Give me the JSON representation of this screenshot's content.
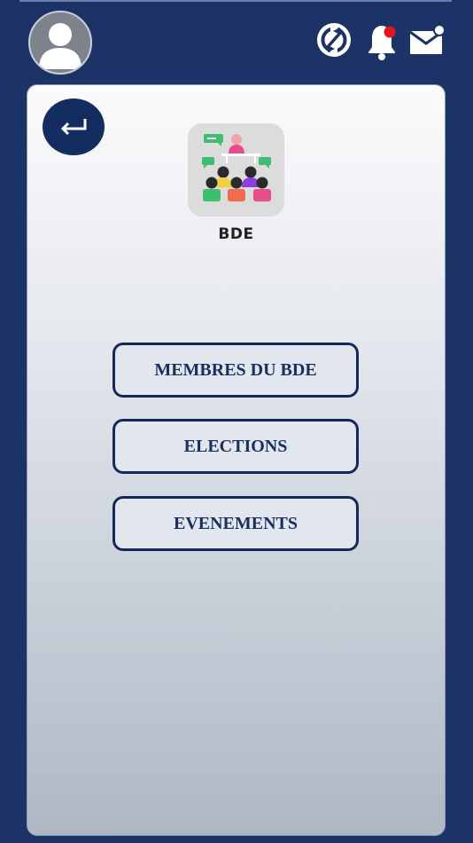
{
  "header": {
    "avatar_icon": "user-avatar-icon",
    "sync_icon": "sync-icon",
    "notification_icon": "bell-icon",
    "notification_badge_color": "#e0161b",
    "mail_icon": "mail-icon"
  },
  "page": {
    "back_icon": "back-arrow-icon",
    "app_icon": "meeting-group-icon",
    "app_name": "BDE"
  },
  "menu": {
    "items": [
      {
        "label": "MEMBRES DU BDE"
      },
      {
        "label": "ELECTIONS"
      },
      {
        "label": "EVENEMENTS"
      }
    ]
  },
  "colors": {
    "background": "#1b3367",
    "button_border": "#14295a",
    "button_fill": "#e1e6ef",
    "button_text": "#1b2f5e"
  }
}
